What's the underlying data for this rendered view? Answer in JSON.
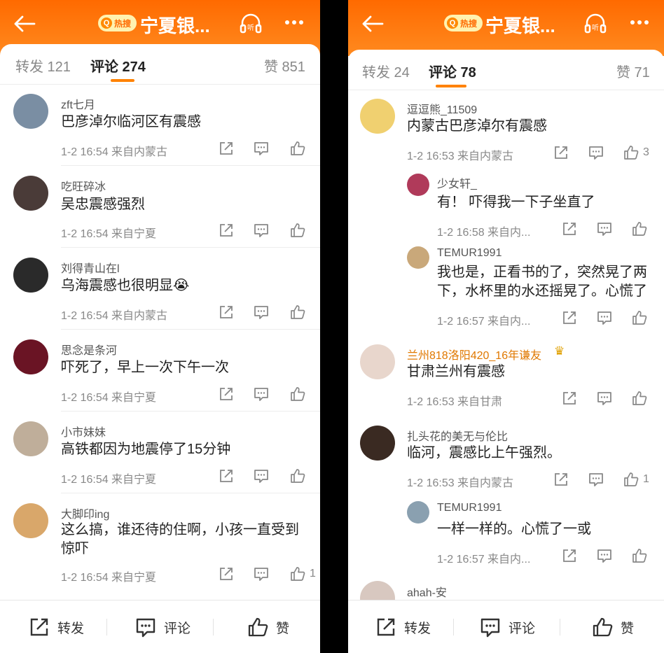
{
  "left": {
    "header": {
      "hot_label": "热搜",
      "title": "宁夏银..."
    },
    "tabs": {
      "repost": "转发 121",
      "comment": "评论 274",
      "like": "赞 851"
    },
    "comments": [
      {
        "user": "zft七月",
        "text": "巴彦淖尔临河区有震感",
        "meta": "1-2 16:54 来自内蒙古",
        "likes": ""
      },
      {
        "user": "吃旺碎冰",
        "text": "吴忠震感强烈",
        "meta": "1-2 16:54 来自宁夏",
        "likes": ""
      },
      {
        "user": "刘得青山在l",
        "text": "乌海震感也很明显😭",
        "meta": "1-2 16:54 来自内蒙古",
        "likes": ""
      },
      {
        "user": "思念是条河",
        "text": "吓死了，早上一次下午一次",
        "meta": "1-2 16:54 来自宁夏",
        "likes": ""
      },
      {
        "user": "小市妹妹",
        "text": "高铁都因为地震停了15分钟",
        "meta": "1-2 16:54 来自宁夏",
        "likes": ""
      },
      {
        "user": "大脚印ing",
        "text": "这么搞，谁还待的住啊，小孩一直受到惊吓",
        "meta": "1-2 16:54 来自宁夏",
        "likes": "1"
      }
    ],
    "bottom": {
      "repost": "转发",
      "comment": "评论",
      "like": "赞"
    }
  },
  "right": {
    "header": {
      "hot_label": "热搜",
      "title": "宁夏银..."
    },
    "tabs": {
      "repost": "转发 24",
      "comment": "评论 78",
      "like": "赞 71"
    },
    "comments": [
      {
        "user": "逗逗熊_11509",
        "text": "内蒙古巴彦淖尔有震感",
        "meta": "1-2 16:53 来自内蒙古",
        "likes": "3"
      },
      {
        "user": "少女轩_",
        "text": "有！ 吓得我一下子坐直了",
        "meta": "1-2 16:58 来自内...",
        "likes": ""
      },
      {
        "user": "TEMUR1991",
        "text": "我也是，正看书的了，突然晃了两下，水杯里的水还摇晃了。心慌了",
        "meta": "1-2 16:57 来自内...",
        "likes": ""
      },
      {
        "user": "兰州818洛阳420_16年谦友",
        "text": "甘肃兰州有震感",
        "meta": "1-2 16:53 来自甘肃",
        "likes": ""
      },
      {
        "user": "扎头花的美无与伦比",
        "text": "临河，震感比上午强烈。",
        "meta": "1-2 16:53 来自内蒙古",
        "likes": "1"
      },
      {
        "user": "TEMUR1991",
        "text": "一样一样的。心慌了一或",
        "meta": "1-2 16:57 来自内...",
        "likes": ""
      },
      {
        "user": "ahah-安"
      }
    ],
    "bottom": {
      "repost": "转发",
      "comment": "评论",
      "like": "赞"
    }
  },
  "icons": {
    "back": "back-arrow-icon",
    "listen": "listen-icon",
    "more": "more-icon",
    "share": "share-icon",
    "comment": "comment-icon",
    "like": "thumbs-up-icon",
    "crown": "crown-icon"
  },
  "colors": {
    "accent": "#ff8200",
    "header_top": "#ff6a00",
    "gold_name": "#e07800"
  }
}
